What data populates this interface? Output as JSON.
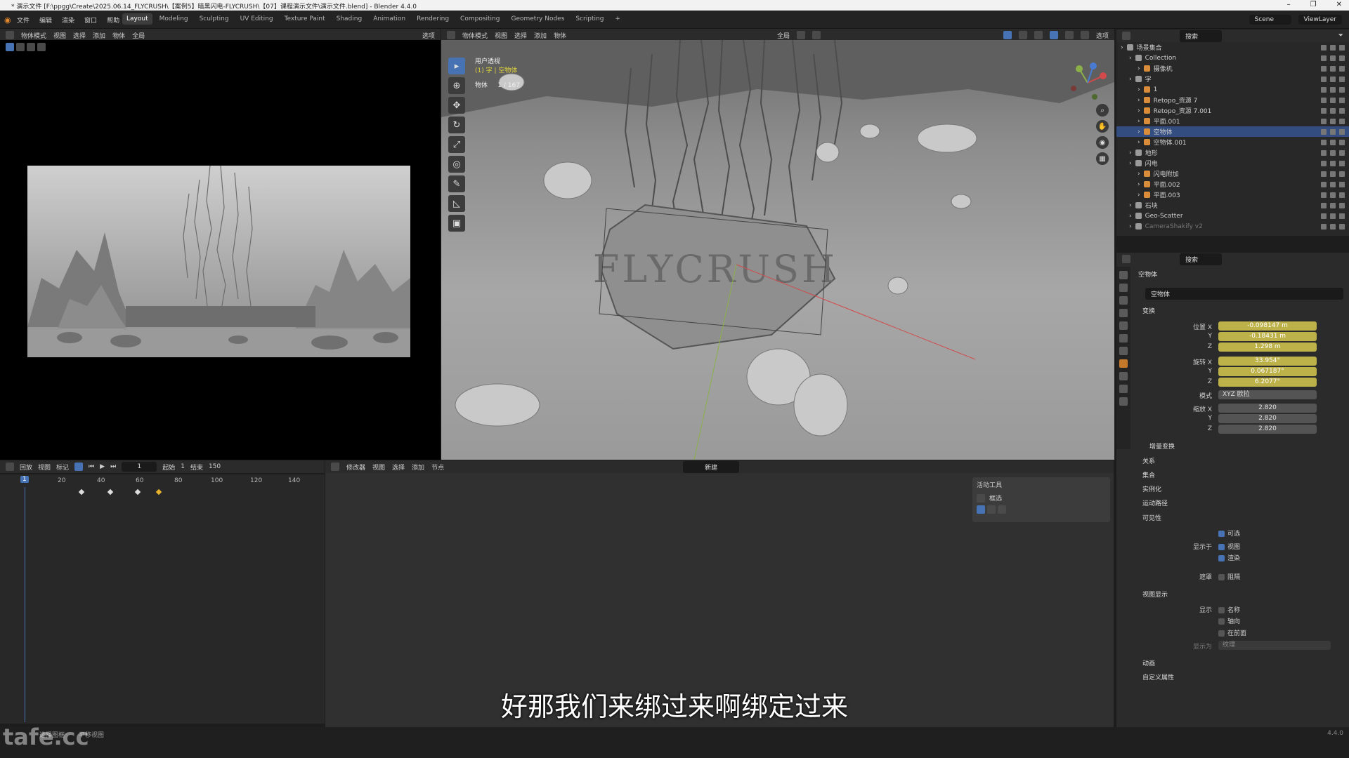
{
  "window": {
    "title": "* 演示文件 [F:\\ppgg\\Create\\2025.06.14_FLYCRUSH\\【案例5】暗黑闪电-FLYCRUSH\\【07】课程演示文件\\演示文件.blend] - Blender 4.4.0",
    "minimize": "–",
    "maximize": "❐",
    "close": "✕"
  },
  "menu": {
    "items": [
      "文件",
      "编辑",
      "渲染",
      "窗口",
      "帮助"
    ]
  },
  "workspaces": [
    "Layout",
    "Modeling",
    "Sculpting",
    "UV Editing",
    "Texture Paint",
    "Shading",
    "Animation",
    "Rendering",
    "Compositing",
    "Geometry Nodes",
    "Scripting",
    "+"
  ],
  "topright": {
    "scene": "Scene",
    "viewlayer": "ViewLayer"
  },
  "cam_header": {
    "mode": "物体模式",
    "items": [
      "视图",
      "选择",
      "添加",
      "物体"
    ],
    "transform": "全局",
    "options": "选项"
  },
  "vp_header": {
    "mode": "物体模式",
    "items": [
      "视图",
      "选择",
      "添加",
      "物体"
    ],
    "transform": "全局",
    "options": "选项"
  },
  "viewport": {
    "view_name": "用户透视",
    "collection_line": "(1) 字 | 空物体",
    "objects_label": "物体",
    "objects_count": "1 / 167"
  },
  "timeline": {
    "menus": [
      "回放",
      "视图",
      "标记"
    ],
    "current_frame": "1",
    "start_label": "起始",
    "start": "1",
    "end_label": "结束",
    "end": "150",
    "ticks": [
      "20",
      "40",
      "60",
      "80",
      "100",
      "120",
      "140"
    ],
    "frame_badge": "1"
  },
  "editor2": {
    "type": "修改器",
    "menus": [
      "视图",
      "选择",
      "添加",
      "节点"
    ],
    "new": "新建"
  },
  "active_tool": {
    "title": "活动工具",
    "tool": "框选"
  },
  "subtitle": "好那我们来绑过来啊绑定过来",
  "outliner": {
    "search": "搜索",
    "rows": [
      {
        "name": "场景集合",
        "indent": 0
      },
      {
        "name": "Collection",
        "indent": 1
      },
      {
        "name": "摄像机",
        "indent": 2
      },
      {
        "name": "字",
        "indent": 1
      },
      {
        "name": "1",
        "indent": 2
      },
      {
        "name": "Retopo_资源 7",
        "indent": 2
      },
      {
        "name": "Retopo_资源 7.001",
        "indent": 2
      },
      {
        "name": "平面.001",
        "indent": 2
      },
      {
        "name": "空物体",
        "indent": 2,
        "selected": true
      },
      {
        "name": "空物体.001",
        "indent": 2
      },
      {
        "name": "地形",
        "indent": 1
      },
      {
        "name": "闪电",
        "indent": 1
      },
      {
        "name": "闪电附加",
        "indent": 2
      },
      {
        "name": "平面.002",
        "indent": 2
      },
      {
        "name": "平面.003",
        "indent": 2
      },
      {
        "name": "石块",
        "indent": 1
      },
      {
        "name": "Geo-Scatter",
        "indent": 1
      },
      {
        "name": "CameraShakify v2",
        "indent": 1
      }
    ]
  },
  "props": {
    "search": "搜索",
    "object": "空物体",
    "object2": "空物体",
    "transform": "变换",
    "loc_label": "位置 X",
    "loc": [
      "-0.098147 m",
      "-0.18431 m",
      "1.298 m"
    ],
    "rot_label": "旋转 X",
    "rot": [
      "33.954°",
      "0.067187°",
      "6.2077°"
    ],
    "mode_label": "模式",
    "mode": "XYZ 欧拉",
    "scale_label": "缩放 X",
    "scale": [
      "2.820",
      "2.820",
      "2.820"
    ],
    "y": "Y",
    "z": "Z",
    "delta": "增量变换",
    "sections": [
      "关系",
      "集合",
      "实例化",
      "运动路径"
    ],
    "visibility": "可见性",
    "selectable": "可选",
    "show_in": "显示于",
    "viewport": "视图",
    "render": "渲染",
    "mask": "遮罩",
    "holdout": "阻隔",
    "viewport_display": "视图显示",
    "show": "显示",
    "name": "名称",
    "axes": "轴向",
    "in_front": "在前面",
    "display_as": "显示为",
    "display_val": "纹理",
    "animation": "动画",
    "custom_props": "自定义属性"
  },
  "status": {
    "left": "选择图框",
    "left2": "平移视图",
    "version": "4.4.0"
  },
  "watermark": "tafe.cc"
}
